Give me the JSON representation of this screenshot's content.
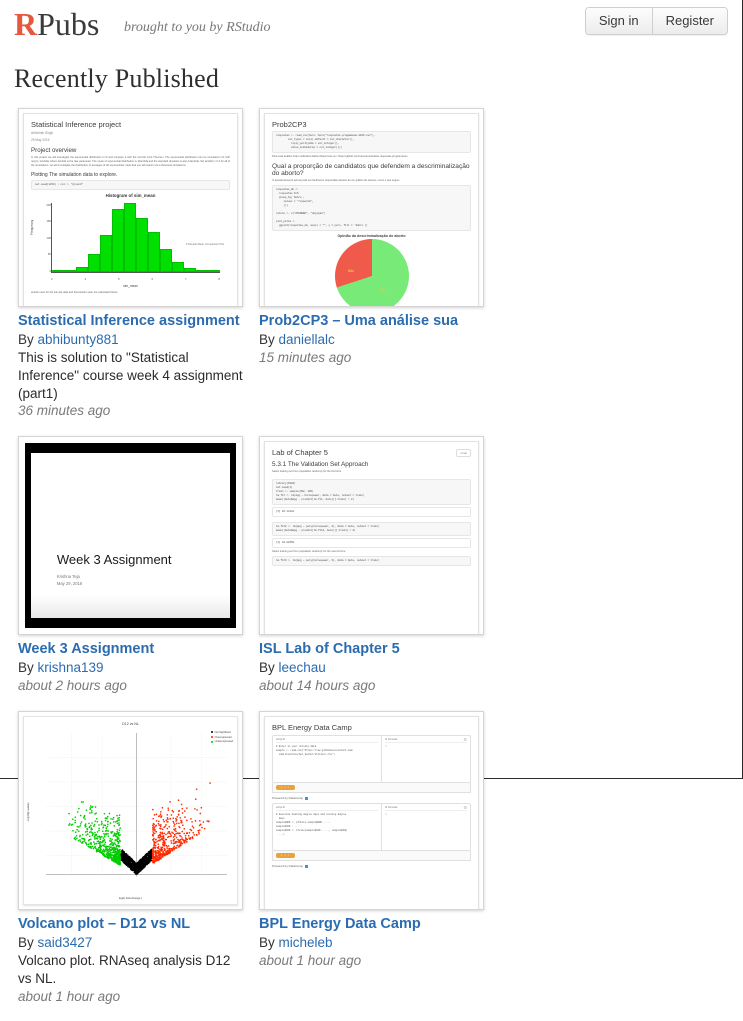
{
  "header": {
    "brand_r": "R",
    "brand_rest": "Pubs",
    "tagline": "brought to you by RStudio",
    "sign_in_label": "Sign in",
    "register_label": "Register",
    "accent_color": "#E8563F",
    "link_color": "#2b6cb0"
  },
  "page": {
    "title": "Recently Published"
  },
  "cards": [
    {
      "title": "Statistical Inference assignment",
      "by_prefix": "By ",
      "author": "abhibunty881",
      "description": "This is solution to \"Statistical Inference\" course week 4 assignment (part1)",
      "time": "36 minutes ago",
      "thumb": {
        "kind": "document-histogram",
        "doc_title": "Statistical Inference project",
        "doc_author": "Abhishek Singh",
        "doc_date": "29 May 2016",
        "doc_heading": "Project overview",
        "doc_paragraph": "In this project we will investigate the exponential distribution in R and compare it with the Central Limit Theorem. The exponential distribution can be simulated in R with rexp(n, lambda) where lambda is the rate parameter. The mean of exponential distribution is 1/lambda and the standard deviation is also 1/lambda. Set lambda = 0.2 for all of the simulations. we will investigate the distribution of averages of 40 exponentials. Note that you will need to do a thousand simulations.",
        "doc_heading2": "Plotting The simulation data to explore.",
        "doc_code": "set.seed(1234)  ; col <- \"green4\"",
        "doc_footnote": "actual mean for the sample data and theoretical mean are calculated below",
        "chart_title": "Histogram of sim_mean",
        "chart_xlabel": "sim_mean",
        "chart_ylabel": "Frequency",
        "chart_side_note": "# Sample Mean Comparison Plot",
        "chart_ytick_labels": [
          "200",
          "150",
          "100",
          "50",
          "0"
        ],
        "chart_xtick_labels": [
          "3",
          "4",
          "5",
          "6",
          "7",
          "8"
        ],
        "bar_values": [
          2,
          4,
          14,
          52,
          110,
          186,
          205,
          160,
          118,
          66,
          30,
          12,
          6,
          4
        ],
        "bar_color": "#00E000"
      }
    },
    {
      "title": "Prob2CP3 – Uma análise sua",
      "by_prefix": "By ",
      "author": "daniellalc",
      "description": "",
      "time": "15 minutes ago",
      "thumb": {
        "kind": "document-pie",
        "doc_title": "Prob2CP3",
        "doc_code1": "respostas <- read_csv(here::here(\"respostas-progamacao-2016.csv\"),\n        col_types = cols(.default = col_character(),\n          reply_perilydia = col_integer(),\n          value_inibidoras = col_integer()))",
        "doc_note": "Para esta análise foram utilizados dados disponíveis em: https://github.com/nazareno/analise-respostas-programacao",
        "doc_heading": "Qual a proporção de candidatos que defendem a descriminalização do aborto?",
        "doc_note2": "O questionamento acima pode ser facilmente respondido através de um gráfico de setores, como o que segue:",
        "doc_code2": "respostas_ab <- \n  respostas %>%\n  group_by(`Sobre`,\n     values = \"resposta\",\n     ()) \n\nrotulo <- c(\"ATENDER\", \"objeção\")\n\nplot_pizza <- \n  ggplot(respostas_ab, aes(x = \"\", y = perc, fill = `Sobre`))",
        "chart_title": "Opinião da descriminalização do aborto",
        "slices": [
          {
            "label": "Sim",
            "percent": 70,
            "color": "#77ea77"
          },
          {
            "label": "Não",
            "percent": 30,
            "color": "#ef5a4a"
          }
        ]
      }
    },
    {
      "title": "Week 3 Assignment",
      "by_prefix": "By ",
      "author": "krishna139",
      "description": "",
      "time": "about 2 hours ago",
      "thumb": {
        "kind": "slide",
        "slide_title": "Week 3 Assignment",
        "slide_author": "Krishna Teja",
        "slide_date": "May 29, 2016",
        "background_color": "#000000"
      }
    },
    {
      "title": "ISL Lab of Chapter 5",
      "by_prefix": "By ",
      "author": "leechau",
      "description": "",
      "time": "about 14 hours ago",
      "thumb": {
        "kind": "document-code",
        "doc_title": "Lab of Chapter 5",
        "doc_heading": "5.3.1 The Validation Set Approach",
        "doc_note": "Select training set from population randomly for the first time",
        "code_toggle_label": "Code",
        "code_blocks": [
          {
            "code": "library(ISLR)\nset.seed(1)\ntrain <- sample(392, 196)\nlm.fit <- lm(mpg ~ horsepower, data = Auto, subset = train)\nmean((Auto$mpg - predict(lm.fit, Auto))[-train] ^ 2)",
            "output": "[1] 26.14142"
          },
          {
            "code": "lm.fit2 <- lm(mpg ~ poly(horsepower, 2), data = Auto, subset = train)\nmean((Auto$mpg - predict(lm.fit2, Auto))[-train] ^ 2)",
            "output": "[1] 19.82259"
          },
          {
            "code": "lm.fit3 <- lm(mpg ~ poly(horsepower, 3), data = Auto, subset = train)",
            "output": ""
          }
        ],
        "note2": "Select training set from population randomly for the second time"
      }
    },
    {
      "title": "Volcano plot – D12 vs NL",
      "by_prefix": "By ",
      "author": "said3427",
      "description": "Volcano plot. RNAseq analysis D12 vs NL.",
      "time": "about 1 hour ago",
      "thumb": {
        "kind": "volcano",
        "chart_title": "D12 vs NL",
        "chart_xlabel": "log2( fold-change )",
        "chart_ylabel": "-log10(p-value)",
        "chart_xtick_labels": [
          "-10",
          "-5",
          "-2",
          "0",
          "2",
          "5",
          "10"
        ],
        "chart_ytick_labels": [
          "0",
          "10",
          "20",
          "30",
          "40",
          "50"
        ],
        "legend": [
          {
            "label": "Not Significant",
            "color": "#000000"
          },
          {
            "label": "Overexpressed",
            "color": "#ff2a00"
          },
          {
            "label": "Underexpressed",
            "color": "#00cc00"
          }
        ]
      }
    },
    {
      "title": "BPL Energy Data Camp",
      "by_prefix": "By ",
      "author": "micheleb",
      "description": "",
      "time": "about 1 hour ago",
      "thumb": {
        "kind": "datacamp",
        "doc_title": "BPL Energy Data Camp",
        "panels": [
          {
            "script_tab": "script.R",
            "console_tab": "R Console",
            "code": "# Enter in your utility data\nsample <- read.csv(\"https://raw.githubusercontent.com/\n  camilleonline/bpl_bpcher/utilizer.csv\")",
            "console": ">",
            "run_label": "• • •"
          },
          {
            "script_tab": "script.R",
            "console_tab": "R Console",
            "code": "# Generate heating degree days and cooling degree\n  days\nsample$HDD <- pfuture.sample$HDD - ...\nsample$CDD - ...\nsample$CDD <- ifelse(sample$CDD - ..., sample$CDD,\n  ...)",
            "console": ">",
            "run_label": "• • •"
          }
        ],
        "powered_label": "Powered by DataCamp",
        "run_button_color": "#e8a33d"
      }
    }
  ]
}
